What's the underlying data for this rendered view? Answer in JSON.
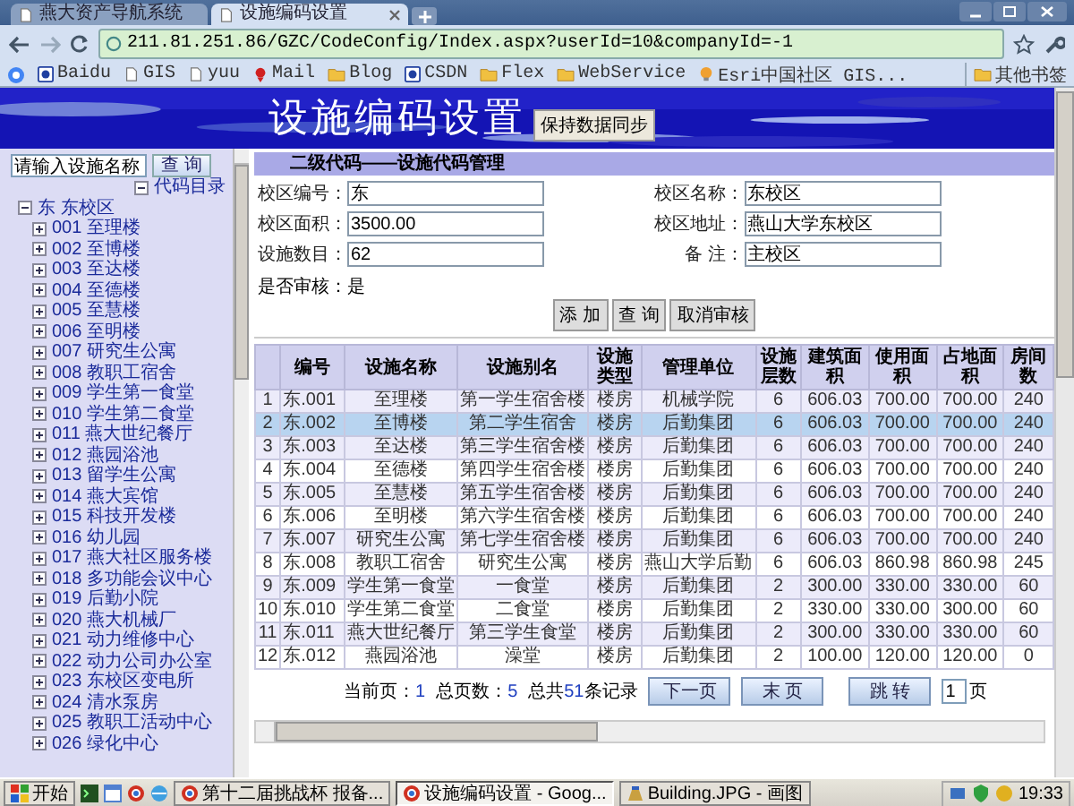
{
  "browser": {
    "tabs": [
      {
        "title": "燕大资产导航系统",
        "selected": false
      },
      {
        "title": "设施编码设置",
        "selected": true
      }
    ],
    "address": "211.81.251.86/GZC/CodeConfig/Index.aspx?userId=10&companyId=-1",
    "bookmarks": [
      {
        "label": "Baidu",
        "kind": "site"
      },
      {
        "label": "GIS",
        "kind": "page"
      },
      {
        "label": "yuu",
        "kind": "page"
      },
      {
        "label": "Mail",
        "kind": "mail"
      },
      {
        "label": "Blog",
        "kind": "folder"
      },
      {
        "label": "CSDN",
        "kind": "site"
      },
      {
        "label": "Flex",
        "kind": "folder"
      },
      {
        "label": "WebService",
        "kind": "folder"
      },
      {
        "label": "Esri中国社区 GIS...",
        "kind": "bulb"
      }
    ],
    "other_bookmarks": "其他书签"
  },
  "banner": {
    "title": "设施编码设置",
    "sync_button": "保持数据同步"
  },
  "sidebar": {
    "search": {
      "value": "请输入设施名称",
      "button": "查 询"
    },
    "tree": [
      {
        "label": "代码目录",
        "expanded": true,
        "children": [
          {
            "label": "东 东校区",
            "expanded": true,
            "children": [
              {
                "label": "001 至理楼",
                "expanded": false
              },
              {
                "label": "002 至博楼",
                "expanded": false
              },
              {
                "label": "003 至达楼",
                "expanded": false
              },
              {
                "label": "004 至德楼",
                "expanded": false
              },
              {
                "label": "005 至慧楼",
                "expanded": false
              },
              {
                "label": "006 至明楼",
                "expanded": false
              },
              {
                "label": "007 研究生公寓",
                "expanded": false
              },
              {
                "label": "008 教职工宿舍",
                "expanded": false
              },
              {
                "label": "009 学生第一食堂",
                "expanded": false
              },
              {
                "label": "010 学生第二食堂",
                "expanded": false
              },
              {
                "label": "011 燕大世纪餐厅",
                "expanded": false
              },
              {
                "label": "012 燕园浴池",
                "expanded": false
              },
              {
                "label": "013 留学生公寓",
                "expanded": false
              },
              {
                "label": "014 燕大宾馆",
                "expanded": false
              },
              {
                "label": "015 科技开发楼",
                "expanded": false
              },
              {
                "label": "016 幼儿园",
                "expanded": false
              },
              {
                "label": "017 燕大社区服务楼",
                "expanded": false
              },
              {
                "label": "018 多功能会议中心",
                "expanded": false
              },
              {
                "label": "019 后勤小院",
                "expanded": false
              },
              {
                "label": "020 燕大机械厂",
                "expanded": false
              },
              {
                "label": "021 动力维修中心",
                "expanded": false
              },
              {
                "label": "022 动力公司办公室",
                "expanded": false
              },
              {
                "label": "023 东校区变电所",
                "expanded": false
              },
              {
                "label": "024 清水泵房",
                "expanded": false
              },
              {
                "label": "025 教职工活动中心",
                "expanded": false
              },
              {
                "label": "026 绿化中心",
                "expanded": false
              }
            ]
          }
        ]
      }
    ]
  },
  "section_title": "二级代码——设施代码管理",
  "form": {
    "fields": [
      {
        "label": "校区编号：",
        "value": "东"
      },
      {
        "label": "校区名称：",
        "value": "东校区"
      },
      {
        "label": "校区面积：",
        "value": "3500.00"
      },
      {
        "label": "校区地址：",
        "value": "燕山大学东校区"
      },
      {
        "label": "设施数目：",
        "value": "62"
      },
      {
        "label": "备 注：",
        "value": "主校区"
      }
    ],
    "audit": "是否审核：是",
    "buttons": [
      "添 加",
      "查 询",
      "取消审核"
    ]
  },
  "table": {
    "columns": [
      "",
      "编号",
      "设施名称",
      "设施别名",
      "设施类型",
      "管理单位",
      "设施层数",
      "建筑面积",
      "使用面积",
      "占地面积",
      "房间数"
    ],
    "rows": [
      {
        "selected": false,
        "cells": [
          "1",
          "东.001",
          "至理楼",
          "第一学生宿舍楼",
          "楼房",
          "机械学院",
          "6",
          "606.03",
          "700.00",
          "700.00",
          "240"
        ]
      },
      {
        "selected": true,
        "cells": [
          "2",
          "东.002",
          "至博楼",
          "第二学生宿舍",
          "楼房",
          "后勤集团",
          "6",
          "606.03",
          "700.00",
          "700.00",
          "240"
        ]
      },
      {
        "selected": false,
        "cells": [
          "3",
          "东.003",
          "至达楼",
          "第三学生宿舍楼",
          "楼房",
          "后勤集团",
          "6",
          "606.03",
          "700.00",
          "700.00",
          "240"
        ]
      },
      {
        "selected": false,
        "cells": [
          "4",
          "东.004",
          "至德楼",
          "第四学生宿舍楼",
          "楼房",
          "后勤集团",
          "6",
          "606.03",
          "700.00",
          "700.00",
          "240"
        ]
      },
      {
        "selected": false,
        "cells": [
          "5",
          "东.005",
          "至慧楼",
          "第五学生宿舍楼",
          "楼房",
          "后勤集团",
          "6",
          "606.03",
          "700.00",
          "700.00",
          "240"
        ]
      },
      {
        "selected": false,
        "cells": [
          "6",
          "东.006",
          "至明楼",
          "第六学生宿舍楼",
          "楼房",
          "后勤集团",
          "6",
          "606.03",
          "700.00",
          "700.00",
          "240"
        ]
      },
      {
        "selected": false,
        "cells": [
          "7",
          "东.007",
          "研究生公寓",
          "第七学生宿舍楼",
          "楼房",
          "后勤集团",
          "6",
          "606.03",
          "700.00",
          "700.00",
          "240"
        ]
      },
      {
        "selected": false,
        "cells": [
          "8",
          "东.008",
          "教职工宿舍",
          "研究生公寓",
          "楼房",
          "燕山大学后勤",
          "6",
          "606.03",
          "860.98",
          "860.98",
          "245"
        ]
      },
      {
        "selected": false,
        "cells": [
          "9",
          "东.009",
          "学生第一食堂",
          "一食堂",
          "楼房",
          "后勤集团",
          "2",
          "300.00",
          "330.00",
          "330.00",
          "60"
        ]
      },
      {
        "selected": false,
        "cells": [
          "10",
          "东.010",
          "学生第二食堂",
          "二食堂",
          "楼房",
          "后勤集团",
          "2",
          "330.00",
          "330.00",
          "300.00",
          "60"
        ]
      },
      {
        "selected": false,
        "cells": [
          "11",
          "东.011",
          "燕大世纪餐厅",
          "第三学生食堂",
          "楼房",
          "后勤集团",
          "2",
          "300.00",
          "330.00",
          "330.00",
          "60"
        ]
      },
      {
        "selected": false,
        "cells": [
          "12",
          "东.012",
          "燕园浴池",
          "澡堂",
          "楼房",
          "后勤集团",
          "2",
          "100.00",
          "120.00",
          "120.00",
          "0"
        ]
      }
    ]
  },
  "pagination": {
    "stats": [
      {
        "label": "当前页：",
        "value": "1"
      },
      {
        "label": "总页数：",
        "value": "5"
      },
      {
        "label": "总共",
        "value": "51",
        "suffix": "条记录"
      }
    ],
    "buttons": [
      "下一页",
      "末 页"
    ],
    "jump_button": "跳 转",
    "page_input": "1",
    "page_unit": "页"
  },
  "taskbar": {
    "start": "开始",
    "items": [
      {
        "label": "第十二届挑战杯 报备...",
        "kind": "browser",
        "selected": false
      },
      {
        "label": "设施编码设置 - Goog...",
        "kind": "browser",
        "selected": true
      },
      {
        "label": "Building.JPG - 画图",
        "kind": "paint",
        "selected": false
      }
    ],
    "clock": "19:33"
  }
}
